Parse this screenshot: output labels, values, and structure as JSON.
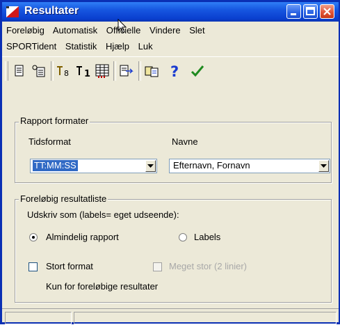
{
  "window": {
    "title": "Resultater"
  },
  "menu": {
    "row1": [
      "Foreløbig",
      "Automatisk",
      "Officielle",
      "Vindere",
      "Slet"
    ],
    "row2": [
      "SPORTident",
      "Statistik",
      "Hjælp",
      "Luk"
    ]
  },
  "toolbar": {
    "icons": [
      "print-preview-icon",
      "print-setup-icon",
      "sort-icon",
      "rank-first-icon",
      "table-icon",
      "export-icon",
      "compare-icon",
      "help-icon",
      "ok-icon"
    ]
  },
  "rapport": {
    "legend": "Rapport formater",
    "tidsformat_label": "Tidsformat",
    "tidsformat_value": "TT:MM:SS",
    "navne_label": "Navne",
    "navne_value": "Efternavn, Fornavn"
  },
  "foreloebig": {
    "legend": "Foreløbig resultatliste",
    "udskriv_label": "Udskriv som (labels= eget udseende):",
    "radio_almindelig": "Almindelig rapport",
    "radio_labels": "Labels",
    "stort_format": "Stort format",
    "meget_stor": "Meget stor (2 linier)",
    "note": "Kun for foreløbige resultater"
  },
  "colors": {
    "titlebar": "#0a3fcf",
    "selection": "#316ac5",
    "ok_check": "#1f8a1f",
    "help": "#1a3cd0"
  }
}
